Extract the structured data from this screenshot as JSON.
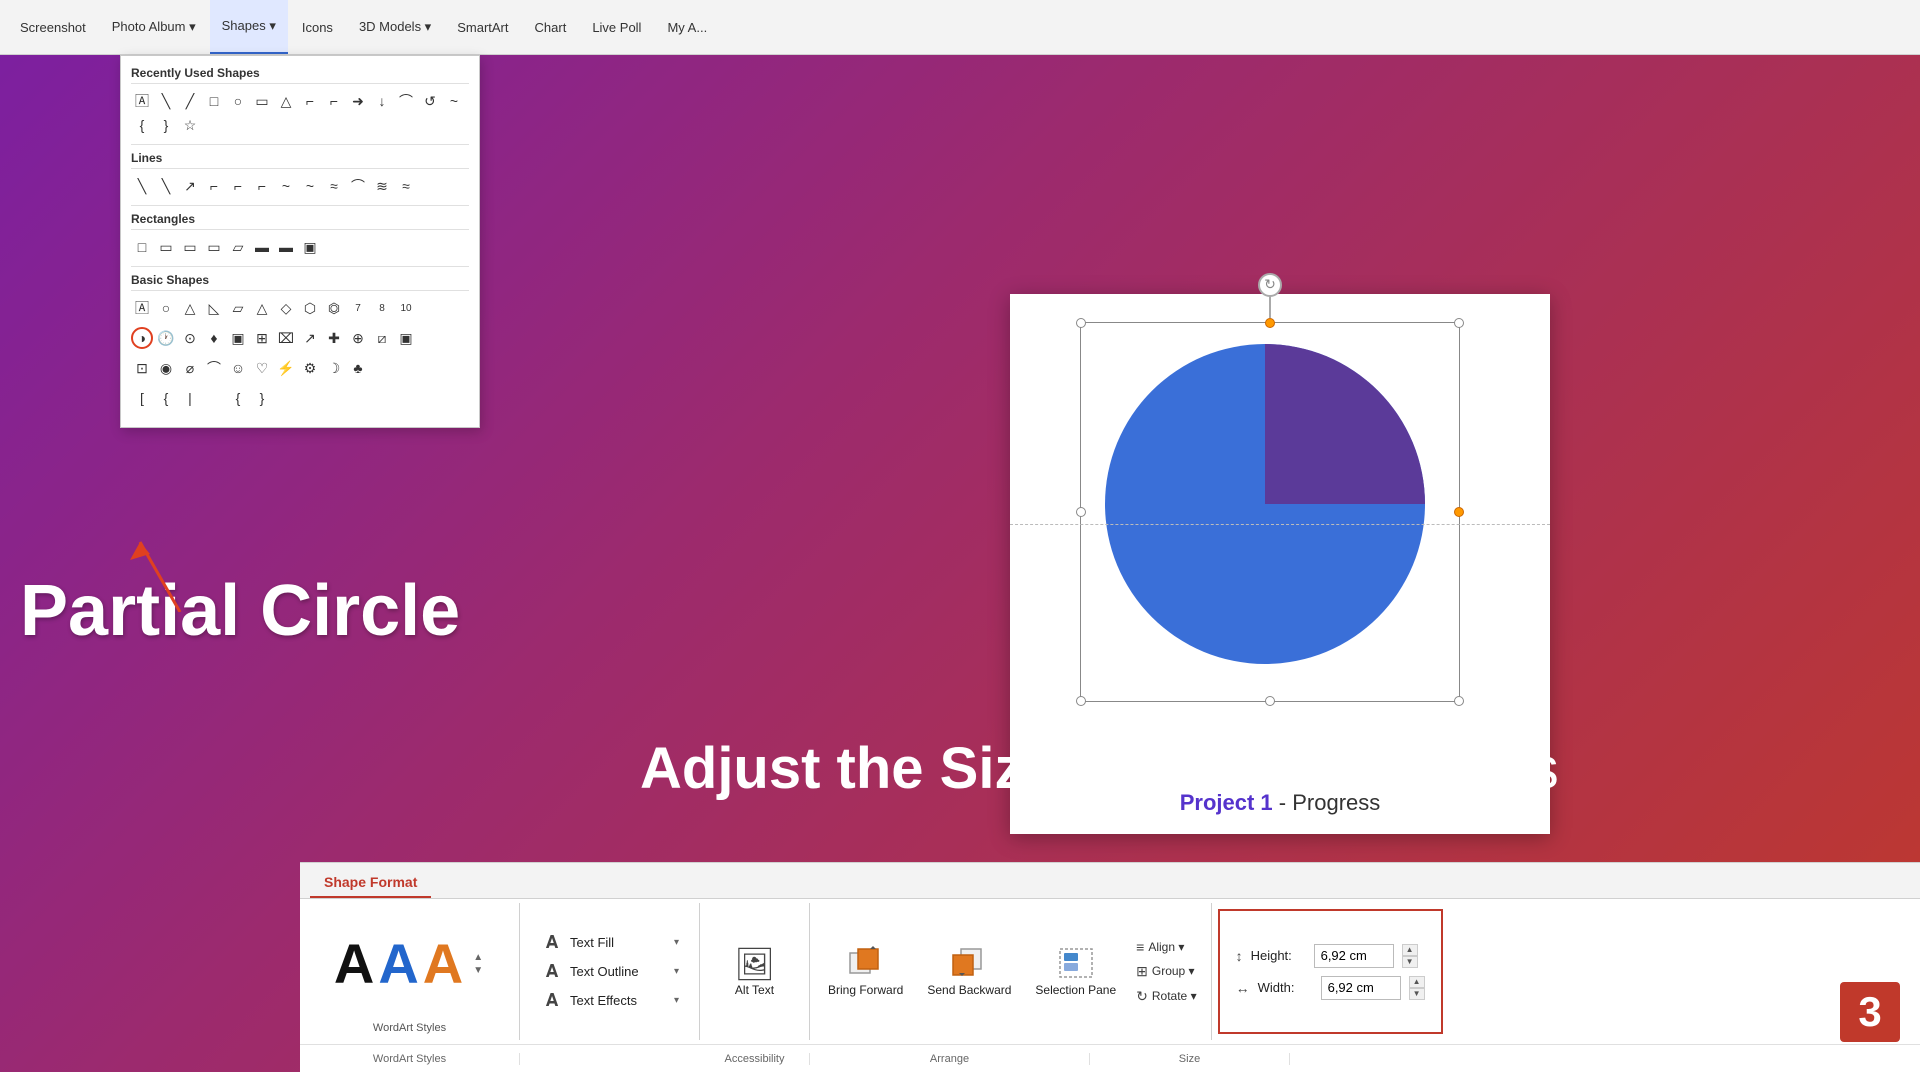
{
  "ribbon": {
    "tabs": [
      {
        "label": "Screenshot",
        "id": "screenshot"
      },
      {
        "label": "Photo Album ▾",
        "id": "photo-album"
      },
      {
        "label": "Shapes ▾",
        "id": "shapes"
      },
      {
        "label": "Icons",
        "id": "icons"
      },
      {
        "label": "3D Models ▾",
        "id": "3d-models"
      },
      {
        "label": "SmartArt",
        "id": "smartart"
      },
      {
        "label": "Chart",
        "id": "chart"
      },
      {
        "label": "Live Poll",
        "id": "live-poll"
      },
      {
        "label": "My A...",
        "id": "my-addins"
      }
    ]
  },
  "shapes_panel": {
    "sections": [
      {
        "title": "Recently Used Shapes",
        "icons": [
          "A",
          "\\",
          "\\",
          "□",
          "○",
          "□",
          "△",
          "⌐",
          "⌐",
          "➜",
          "↓",
          "⌒",
          "↺",
          "↗",
          "↙",
          "{}",
          "{}",
          "☆"
        ]
      },
      {
        "title": "Lines",
        "icons": [
          "\\",
          "\\",
          "↗",
          "⌐",
          "⌐",
          "⌐",
          "⌐",
          "~",
          "~",
          "~",
          "~",
          "⌒",
          "⌒",
          "⌒",
          "≈"
        ]
      },
      {
        "title": "Rectangles",
        "icons": [
          "□",
          "▭",
          "▭",
          "▭",
          "▭",
          "▭",
          "▭",
          "▭",
          "▭"
        ]
      },
      {
        "title": "Basic Shapes",
        "icons": [
          "A",
          "○",
          "△",
          "△",
          "▱",
          "△",
          "◇",
          "⬡",
          "⬡",
          "7",
          "8",
          "10",
          "◑",
          "🕐",
          "⊙",
          "▣",
          "⊞",
          "⌧",
          "↗",
          "✚",
          "⊕",
          "⧄",
          "▣",
          "⊡",
          "◉",
          "⌀",
          "⌒",
          "□",
          "☺",
          "♡",
          "⚡",
          "⚙",
          "☽",
          "♣",
          "(",
          "[",
          "{",
          "[",
          "{",
          "[",
          "["
        ]
      }
    ]
  },
  "highlighted_shape": {
    "tooltip": "Partial Circle",
    "position": "row4_col2"
  },
  "slide": {
    "title_bold": "Project 1",
    "title_dash": " - ",
    "title_normal": "Progress"
  },
  "annotation": {
    "partial_circle_text": "Partial Circle",
    "adjust_text_bold": "Adjust the Sizes",
    "adjust_text_normal": " of the two shapes"
  },
  "toolbar": {
    "active_tab": "Shape Format",
    "wordart": {
      "letters": [
        {
          "char": "A",
          "style": "black"
        },
        {
          "char": "A",
          "style": "blue"
        },
        {
          "char": "A",
          "style": "orange"
        }
      ],
      "section_label": "WordArt Styles"
    },
    "text_effects": {
      "text_fill": "Text Fill",
      "text_outline": "Text Outline",
      "text_effects": "Text Effects",
      "section_label": ""
    },
    "accessibility": {
      "label": "Alt Text",
      "section_label": "Accessibility"
    },
    "arrange": {
      "bring_forward": "Bring Forward",
      "send_backward": "Send Backward",
      "selection_pane": "Selection Pane",
      "align": "Align ▾",
      "group": "Group ▾",
      "rotate": "Rotate ▾",
      "section_label": "Arrange"
    },
    "size": {
      "height_label": "Height:",
      "height_value": "6,92 cm",
      "width_label": "Width:",
      "width_value": "6,92 cm",
      "section_label": "Size"
    }
  },
  "step_badge": "3"
}
